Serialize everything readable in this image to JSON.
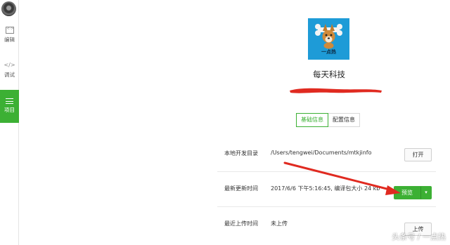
{
  "sidebar": {
    "items": [
      {
        "label": "编辑",
        "icon": "code-icon"
      },
      {
        "label": "调试",
        "icon": "debug-icon"
      },
      {
        "label": "项目",
        "icon": "menu-icon",
        "active": true
      }
    ],
    "active_color": "#3cb034"
  },
  "app": {
    "icon_text": "一点热",
    "name": "每天科技"
  },
  "tabs": [
    {
      "label": "基础信息",
      "active": true
    },
    {
      "label": "配置信息",
      "active": false
    }
  ],
  "rows": {
    "local_dir": {
      "label": "本地开发目录",
      "value": "/Users/tengwei/Documents/mtkjinfo",
      "button": "打开"
    },
    "last_update": {
      "label": "最新更新时间",
      "value": "2017/6/6 下午5:16:45, 编译包大小 24 kb",
      "button": "预览",
      "dropdown": "▾"
    },
    "last_upload": {
      "label": "最近上传时间",
      "value": "未上传",
      "button": "上传"
    }
  },
  "watermark": "头条号 / 一点热",
  "colors": {
    "accent": "#3cb034",
    "annotation": "#e02a20",
    "app_icon_bg": "#1e9bd7"
  }
}
